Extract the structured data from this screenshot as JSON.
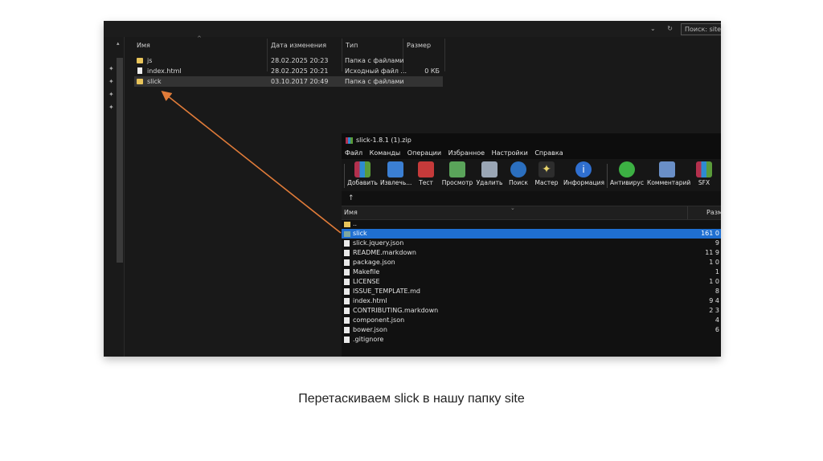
{
  "explorer": {
    "search_placeholder": "Поиск: site",
    "columns": {
      "name": "Имя",
      "date": "Дата изменения",
      "type": "Тип",
      "size": "Размер"
    },
    "rows": [
      {
        "name": "js",
        "date": "28.02.2025 20:23",
        "type": "Папка с файлами",
        "size": ""
      },
      {
        "name": "index.html",
        "date": "28.02.2025 20:21",
        "type": "Исходный файл ...",
        "size": "0 КБ"
      },
      {
        "name": "slick",
        "date": "03.10.2017 20:49",
        "type": "Папка с файлами",
        "size": ""
      }
    ]
  },
  "winrar": {
    "title": "slick-1.8.1 (1).zip",
    "menu": [
      "Файл",
      "Команды",
      "Операции",
      "Избранное",
      "Настройки",
      "Справка"
    ],
    "toolbar": {
      "add": "Добавить",
      "extract": "Извлечь...",
      "test": "Тест",
      "view": "Просмотр",
      "delete": "Удалить",
      "find": "Поиск",
      "wizard": "Мастер",
      "info": "Информация",
      "antivirus": "Антивирус",
      "comment": "Комментарий",
      "sfx": "SFX"
    },
    "up_arrow": "↑",
    "columns": {
      "name": "Имя",
      "size": "Разме"
    },
    "rows": [
      {
        "name": "..",
        "size": ""
      },
      {
        "name": "slick",
        "size": "161 0"
      },
      {
        "name": "slick.jquery.json",
        "size": "9"
      },
      {
        "name": "README.markdown",
        "size": "11 9"
      },
      {
        "name": "package.json",
        "size": "1 0"
      },
      {
        "name": "Makefile",
        "size": "1"
      },
      {
        "name": "LICENSE",
        "size": "1 0"
      },
      {
        "name": "ISSUE_TEMPLATE.md",
        "size": "8"
      },
      {
        "name": "index.html",
        "size": "9 4"
      },
      {
        "name": "CONTRIBUTING.markdown",
        "size": "2 3"
      },
      {
        "name": "component.json",
        "size": "4"
      },
      {
        "name": "bower.json",
        "size": "6"
      },
      {
        "name": ".gitignore",
        "size": ""
      }
    ]
  },
  "caption": "Перетаскиваем slick в нашу папку site",
  "colors": {
    "selection": "#1f6fd1",
    "arrow": "#e07b39",
    "folder": "#e8c45a"
  }
}
